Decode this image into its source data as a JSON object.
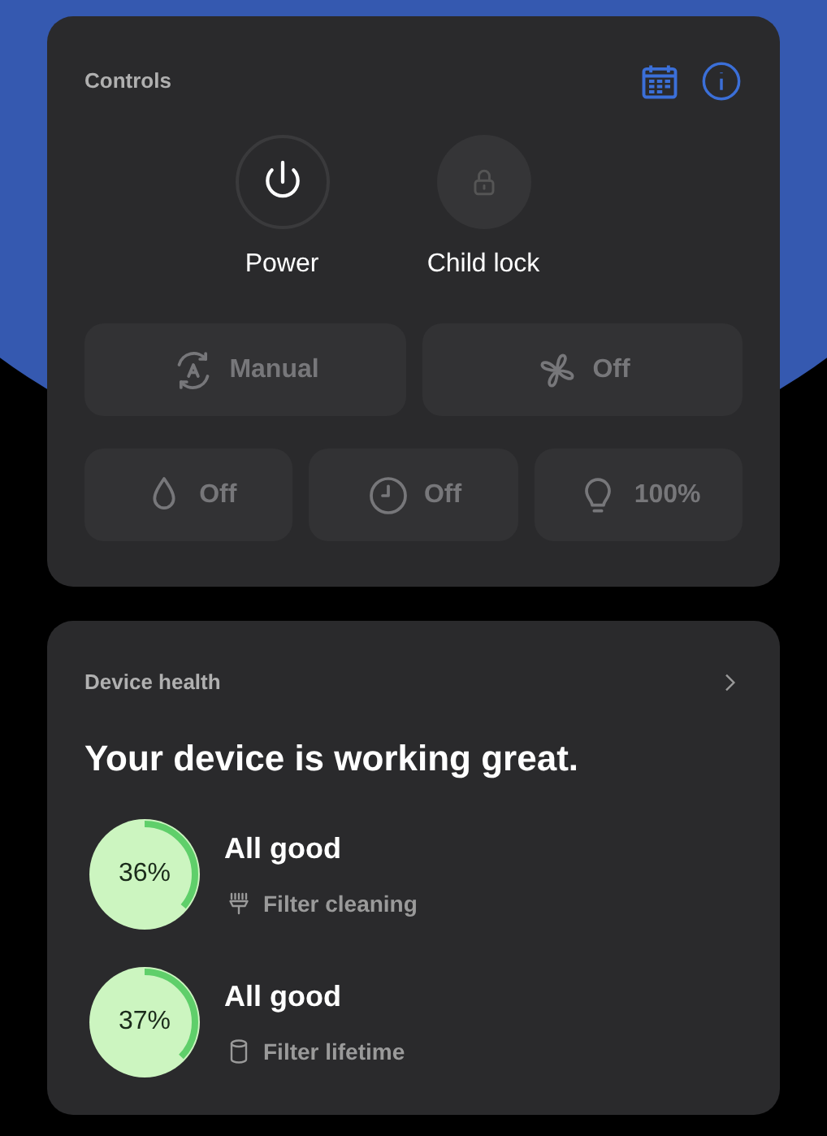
{
  "controls": {
    "title": "Controls",
    "toggles": [
      {
        "kind": "power",
        "label": "Power",
        "disabled": false
      },
      {
        "kind": "lock",
        "label": "Child lock",
        "disabled": true
      }
    ],
    "button_rows": [
      {
        "buttons": [
          {
            "kind": "auto",
            "label": "Manual",
            "disabled": true
          },
          {
            "kind": "fan",
            "label": "Off",
            "disabled": true
          }
        ]
      },
      {
        "buttons": [
          {
            "kind": "drop",
            "label": "Off",
            "disabled": true
          },
          {
            "kind": "timer",
            "label": "Off",
            "disabled": true
          },
          {
            "kind": "bulb",
            "label": "100%",
            "disabled": true
          }
        ]
      }
    ]
  },
  "device_health": {
    "title": "Device health",
    "headline": "Your device is working great.",
    "items": [
      {
        "kind": "cleaning",
        "reading": "36%",
        "level": 0.36,
        "status": "All good",
        "label": "Filter cleaning"
      },
      {
        "kind": "lifetime",
        "reading": "37%",
        "level": 0.37,
        "status": "All good",
        "label": "Filter lifetime"
      }
    ]
  }
}
